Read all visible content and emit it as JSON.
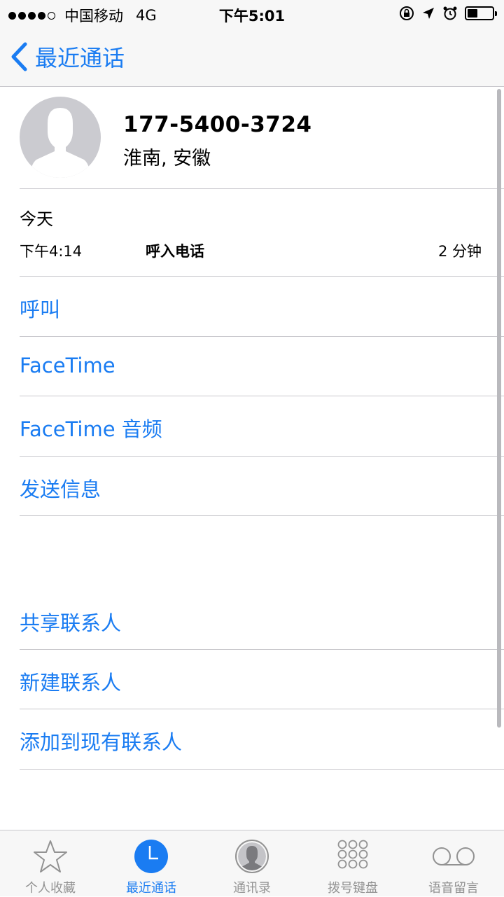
{
  "status_bar": {
    "carrier": "中国移动",
    "network": "4G",
    "time": "下午5:01",
    "battery_level": 0.4
  },
  "nav": {
    "back_label": "最近通话"
  },
  "contact": {
    "phone_number": "177-5400-3724",
    "location": "淮南, 安徽"
  },
  "call_log": {
    "day": "今天",
    "time": "下午4:14",
    "type": "呼入电话",
    "duration": "2 分钟"
  },
  "actions": {
    "call": "呼叫",
    "facetime": "FaceTime",
    "facetime_audio": "FaceTime 音频",
    "send_message": "发送信息",
    "share_contact": "共享联系人",
    "new_contact": "新建联系人",
    "add_existing": "添加到现有联系人"
  },
  "tabs": [
    {
      "label": "个人收藏",
      "icon": "star-icon"
    },
    {
      "label": "最近通话",
      "icon": "clock-icon"
    },
    {
      "label": "通讯录",
      "icon": "contacts-icon"
    },
    {
      "label": "拨号键盘",
      "icon": "keypad-icon"
    },
    {
      "label": "语音留言",
      "icon": "voicemail-icon"
    }
  ],
  "colors": {
    "accent": "#1a7cf2",
    "separator": "#c8c7cc",
    "inactive_tab": "#929292"
  }
}
